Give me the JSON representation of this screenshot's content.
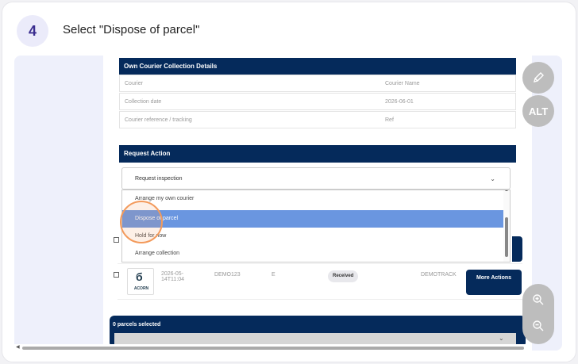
{
  "step": {
    "number": "4",
    "title": "Select \"Dispose of parcel\""
  },
  "collection_details": {
    "header": "Own Courier Collection Details",
    "rows": [
      {
        "label": "Courier",
        "value": "Courier Name"
      },
      {
        "label": "Collection date",
        "value": "2026-06-01"
      },
      {
        "label": "Courier reference / tracking",
        "value": "Ref"
      }
    ]
  },
  "request_action": {
    "header": "Request Action",
    "selected": "Request inspection",
    "options": [
      {
        "label": "Arrange my own courier"
      },
      {
        "label": "Dispose of parcel"
      },
      {
        "label": "Hold for now"
      },
      {
        "label": "Arrange collection"
      }
    ],
    "highlighted": "Dispose of parcel"
  },
  "parcel_row": {
    "logo_text": "ACORN",
    "date": "2026-05-14T11:04",
    "reference": "DEMO123",
    "service": "E",
    "status": "Received",
    "tracking": "DEMOTRACK",
    "button": "More Actions"
  },
  "footer": {
    "selected_count": "0 parcels selected"
  },
  "tools": {
    "alt": "ALT",
    "icons": [
      "pencil-icon",
      "zoom-in-icon",
      "zoom-out-icon"
    ]
  },
  "colors": {
    "navy": "#052a5b",
    "highlight_option": "#6a96e0",
    "marker": "#f39a5b",
    "badge_bg": "#ebebfa"
  }
}
